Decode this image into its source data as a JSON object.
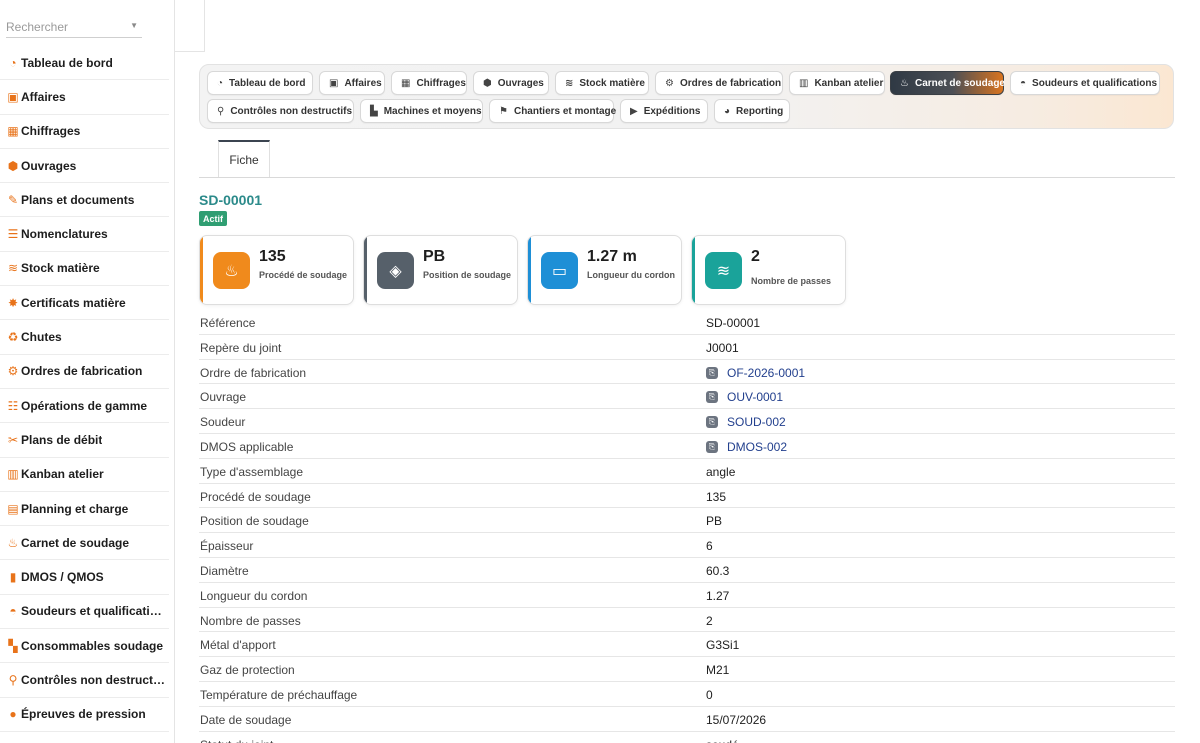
{
  "sidebar": {
    "search_placeholder": "Rechercher",
    "items": [
      {
        "label": "Tableau de bord",
        "icon": "dashboard-icon"
      },
      {
        "label": "Affaires",
        "icon": "briefcase-icon"
      },
      {
        "label": "Chiffrages",
        "icon": "calculator-icon"
      },
      {
        "label": "Ouvrages",
        "icon": "box-icon"
      },
      {
        "label": "Plans et documents",
        "icon": "drafting-icon"
      },
      {
        "label": "Nomenclatures",
        "icon": "list-icon"
      },
      {
        "label": "Stock matière",
        "icon": "layers-icon"
      },
      {
        "label": "Certificats matière",
        "icon": "certificate-icon"
      },
      {
        "label": "Chutes",
        "icon": "recycle-icon"
      },
      {
        "label": "Ordres de fabrication",
        "icon": "gears-icon"
      },
      {
        "label": "Opérations de gamme",
        "icon": "tasks-icon"
      },
      {
        "label": "Plans de débit",
        "icon": "scissors-icon"
      },
      {
        "label": "Kanban atelier",
        "icon": "kanban-icon"
      },
      {
        "label": "Planning et charge",
        "icon": "calendar-icon"
      },
      {
        "label": "Carnet de soudage",
        "icon": "flame-icon"
      },
      {
        "label": "DMOS / QMOS",
        "icon": "document-icon"
      },
      {
        "label": "Soudeurs et qualifications",
        "icon": "helmet-icon"
      },
      {
        "label": "Consommables soudage",
        "icon": "consumables-icon"
      },
      {
        "label": "Contrôles non destructifs",
        "icon": "magnifier-icon"
      },
      {
        "label": "Épreuves de pression",
        "icon": "drop-icon"
      }
    ]
  },
  "menu": {
    "row1": [
      {
        "label": "Tableau de bord",
        "icon": "dashboard-icon",
        "active": false
      },
      {
        "label": "Affaires",
        "icon": "briefcase-icon",
        "active": false
      },
      {
        "label": "Chiffrages",
        "icon": "calculator-icon",
        "active": false
      },
      {
        "label": "Ouvrages",
        "icon": "box-icon",
        "active": false
      },
      {
        "label": "Stock matière",
        "icon": "layers-icon",
        "active": false
      },
      {
        "label": "Ordres de fabrication",
        "icon": "gears-icon",
        "active": false
      },
      {
        "label": "Kanban atelier",
        "icon": "kanban-icon",
        "active": false
      },
      {
        "label": "Carnet de soudage",
        "icon": "flame-icon",
        "active": true
      },
      {
        "label": "Soudeurs et qualifications",
        "icon": "helmet-icon",
        "active": false
      }
    ],
    "row2": [
      {
        "label": "Contrôles non destructifs",
        "icon": "magnifier-icon",
        "active": false
      },
      {
        "label": "Machines et moyens",
        "icon": "factory-icon",
        "active": false
      },
      {
        "label": "Chantiers et montage",
        "icon": "map-pin-icon",
        "active": false
      },
      {
        "label": "Expéditions",
        "icon": "truck-icon",
        "active": false
      },
      {
        "label": "Reporting",
        "icon": "pie-chart-icon",
        "active": false
      }
    ]
  },
  "tabs": {
    "fiche": "Fiche"
  },
  "record": {
    "id": "SD-00001",
    "status": "Actif",
    "status_color": "#2f9e72"
  },
  "kpis": [
    {
      "value": "135",
      "label": "Procédé de soudage",
      "icon": "flame-icon",
      "accent": "#f08a1c"
    },
    {
      "value": "PB",
      "label": "Position de soudage",
      "icon": "compass-icon",
      "accent": "#56606a"
    },
    {
      "value": "1.27 m",
      "label": "Longueur du cordon",
      "icon": "ruler-icon",
      "accent": "#1e8fd6"
    },
    {
      "value": "2",
      "label": "Nombre de passes",
      "icon": "layers-icon",
      "accent": "#1aa39a"
    }
  ],
  "fields": [
    {
      "key": "Référence",
      "value": "SD-00001",
      "link": false
    },
    {
      "key": "Repère du joint",
      "value": "J0001",
      "link": false
    },
    {
      "key": "Ordre de fabrication",
      "value": "OF-2026-0001",
      "link": true
    },
    {
      "key": "Ouvrage",
      "value": "OUV-0001",
      "link": true
    },
    {
      "key": "Soudeur",
      "value": "SOUD-002",
      "link": true
    },
    {
      "key": "DMOS applicable",
      "value": "DMOS-002",
      "link": true
    },
    {
      "key": "Type d'assemblage",
      "value": "angle",
      "link": false
    },
    {
      "key": "Procédé de soudage",
      "value": "135",
      "link": false
    },
    {
      "key": "Position de soudage",
      "value": "PB",
      "link": false
    },
    {
      "key": "Épaisseur",
      "value": "6",
      "link": false
    },
    {
      "key": "Diamètre",
      "value": "60.3",
      "link": false
    },
    {
      "key": "Longueur du cordon",
      "value": "1.27",
      "link": false
    },
    {
      "key": "Nombre de passes",
      "value": "2",
      "link": false
    },
    {
      "key": "Métal d'apport",
      "value": "G3Si1",
      "link": false
    },
    {
      "key": "Gaz de protection",
      "value": "M21",
      "link": false
    },
    {
      "key": "Température de préchauffage",
      "value": "0",
      "link": false
    },
    {
      "key": "Date de soudage",
      "value": "15/07/2026",
      "link": false
    },
    {
      "key": "Statut du joint",
      "value": "soudé",
      "link": false
    }
  ]
}
